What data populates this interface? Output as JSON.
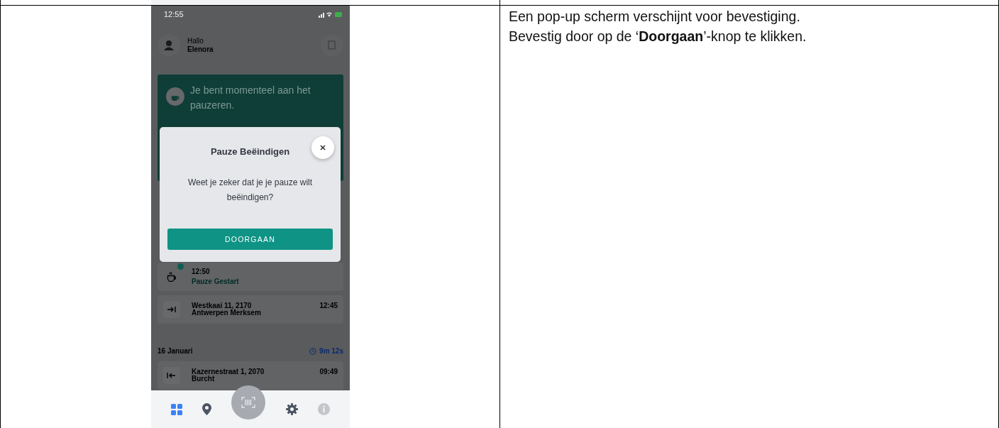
{
  "status_bar": {
    "time": "12:55"
  },
  "header": {
    "greeting": "Hallo",
    "name": "Elenora"
  },
  "banner": {
    "text": "Je bent momenteel aan het pauzeren."
  },
  "dialog": {
    "title": "Pauze Beëindigen",
    "message": "Weet je zeker dat je je pauze wilt beëindigen?",
    "button": "DOORGAAN"
  },
  "entries": [
    {
      "kind": "pause",
      "time": "12:50",
      "label": "Pauze Gestart"
    },
    {
      "kind": "in",
      "address_line_1": "Westkaai 11, 2170",
      "address_line_2": "Antwerpen Merksem",
      "time": "12:45"
    }
  ],
  "day": {
    "date": "16 Januari",
    "duration": "9m 12s"
  },
  "day_entries": [
    {
      "kind": "out",
      "address_line_1": "Kazernestraat 1, 2070",
      "address_line_2": "Burcht",
      "time": "09:49"
    }
  ],
  "nav": [
    {
      "kind": "dashboard",
      "selected": true
    },
    {
      "kind": "location",
      "selected": false
    },
    {
      "kind": "scan",
      "selected": false
    },
    {
      "kind": "settings",
      "selected": false
    },
    {
      "kind": "info",
      "selected": false
    }
  ],
  "description": [
    "Een pop-up scherm verschijnt voor bevestiging.",
    "Bevestig door op de ‘**Doorgaan**’-knop te klikken."
  ]
}
